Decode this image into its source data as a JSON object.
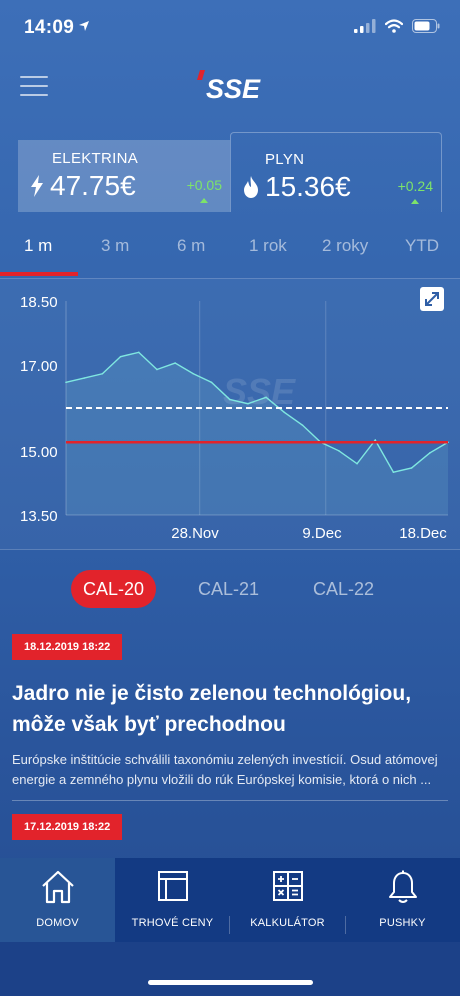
{
  "status_bar": {
    "time": "14:09"
  },
  "header": {
    "logo_text": "SSE"
  },
  "energy": [
    {
      "label": "ELEKTRINA",
      "price": "47.75€",
      "change": "+0.05"
    },
    {
      "label": "PLYN",
      "price": "15.36€",
      "change": "+0.24"
    }
  ],
  "periods": [
    "1 m",
    "3 m",
    "6 m",
    "1 rok",
    "2 roky",
    "YTD"
  ],
  "chart_data": {
    "type": "line",
    "watermark": "SSE",
    "y_ticks": [
      "18.50",
      "17.00",
      "15.00",
      "13.50"
    ],
    "ylim": [
      13.5,
      18.5
    ],
    "x_ticks": [
      "28.Nov",
      "9.Dec",
      "18.Dec"
    ],
    "series": [
      {
        "values": [
          16.6,
          16.7,
          16.8,
          17.2,
          17.3,
          16.9,
          17.05,
          16.8,
          16.6,
          16.2,
          16.1,
          16.25,
          15.9,
          15.6,
          15.2,
          15.0,
          14.7,
          15.25,
          14.5,
          14.6,
          14.95,
          15.2
        ]
      }
    ],
    "reference_lines": [
      {
        "value": 16.0,
        "style": "dashed",
        "color": "#ffffff"
      },
      {
        "value": 15.2,
        "style": "solid",
        "color": "#e2232b"
      }
    ],
    "line_color": "#7fe7e0",
    "grid": true
  },
  "cal_tabs": [
    "CAL-20",
    "CAL-21",
    "CAL-22"
  ],
  "news": [
    {
      "date": "18.12.2019 18:22",
      "title": "Jadro nie je čisto zelenou technológiou, môže však byť prechodnou",
      "excerpt": "Európske inštitúcie schválili taxonómiu zelených investícií. Osud atómovej energie a zemného plynu vložili do rúk Európskej komisie, ktorá o nich ..."
    },
    {
      "date": "17.12.2019 18:22"
    }
  ],
  "bottom_nav": [
    "DOMOV",
    "TRHOVÉ CENY",
    "KALKULÁTOR",
    "PUSHKY"
  ],
  "colors": {
    "accent": "#e2232b",
    "positive": "#7de36a",
    "nav_bg": "#133a83"
  }
}
